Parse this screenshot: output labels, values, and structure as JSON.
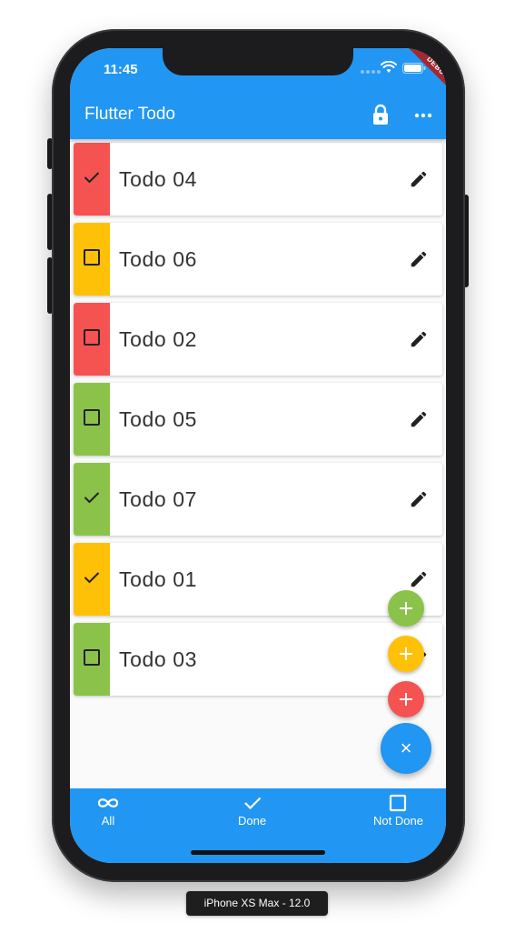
{
  "status_bar": {
    "time": "11:45"
  },
  "debug_banner": "DEBUG",
  "app_bar": {
    "title": "Flutter Todo"
  },
  "colors": {
    "primary": "#2196f3",
    "priority_high": "#f55352",
    "priority_medium": "#ffc107",
    "priority_low": "#8bc34a"
  },
  "todos": [
    {
      "title": "Todo 04",
      "priority_color": "#f55352",
      "done": true
    },
    {
      "title": "Todo 06",
      "priority_color": "#ffc107",
      "done": false
    },
    {
      "title": "Todo 02",
      "priority_color": "#f55352",
      "done": false
    },
    {
      "title": "Todo 05",
      "priority_color": "#8bc34a",
      "done": false
    },
    {
      "title": "Todo 07",
      "priority_color": "#8bc34a",
      "done": true
    },
    {
      "title": "Todo 01",
      "priority_color": "#ffc107",
      "done": true
    },
    {
      "title": "Todo 03",
      "priority_color": "#8bc34a",
      "done": false
    }
  ],
  "fabs": [
    {
      "icon": "plus-icon",
      "color": "#8bc34a"
    },
    {
      "icon": "plus-icon",
      "color": "#ffc107"
    },
    {
      "icon": "plus-icon",
      "color": "#f55352"
    }
  ],
  "main_fab": {
    "icon": "close-icon",
    "glyph": "×"
  },
  "bottom_nav": {
    "items": [
      {
        "label": "All",
        "icon": "infinity-icon"
      },
      {
        "label": "Done",
        "icon": "check-icon"
      },
      {
        "label": "Not Done",
        "icon": "checkbox-outline-icon"
      }
    ]
  },
  "device_label": "iPhone XS Max - 12.0"
}
